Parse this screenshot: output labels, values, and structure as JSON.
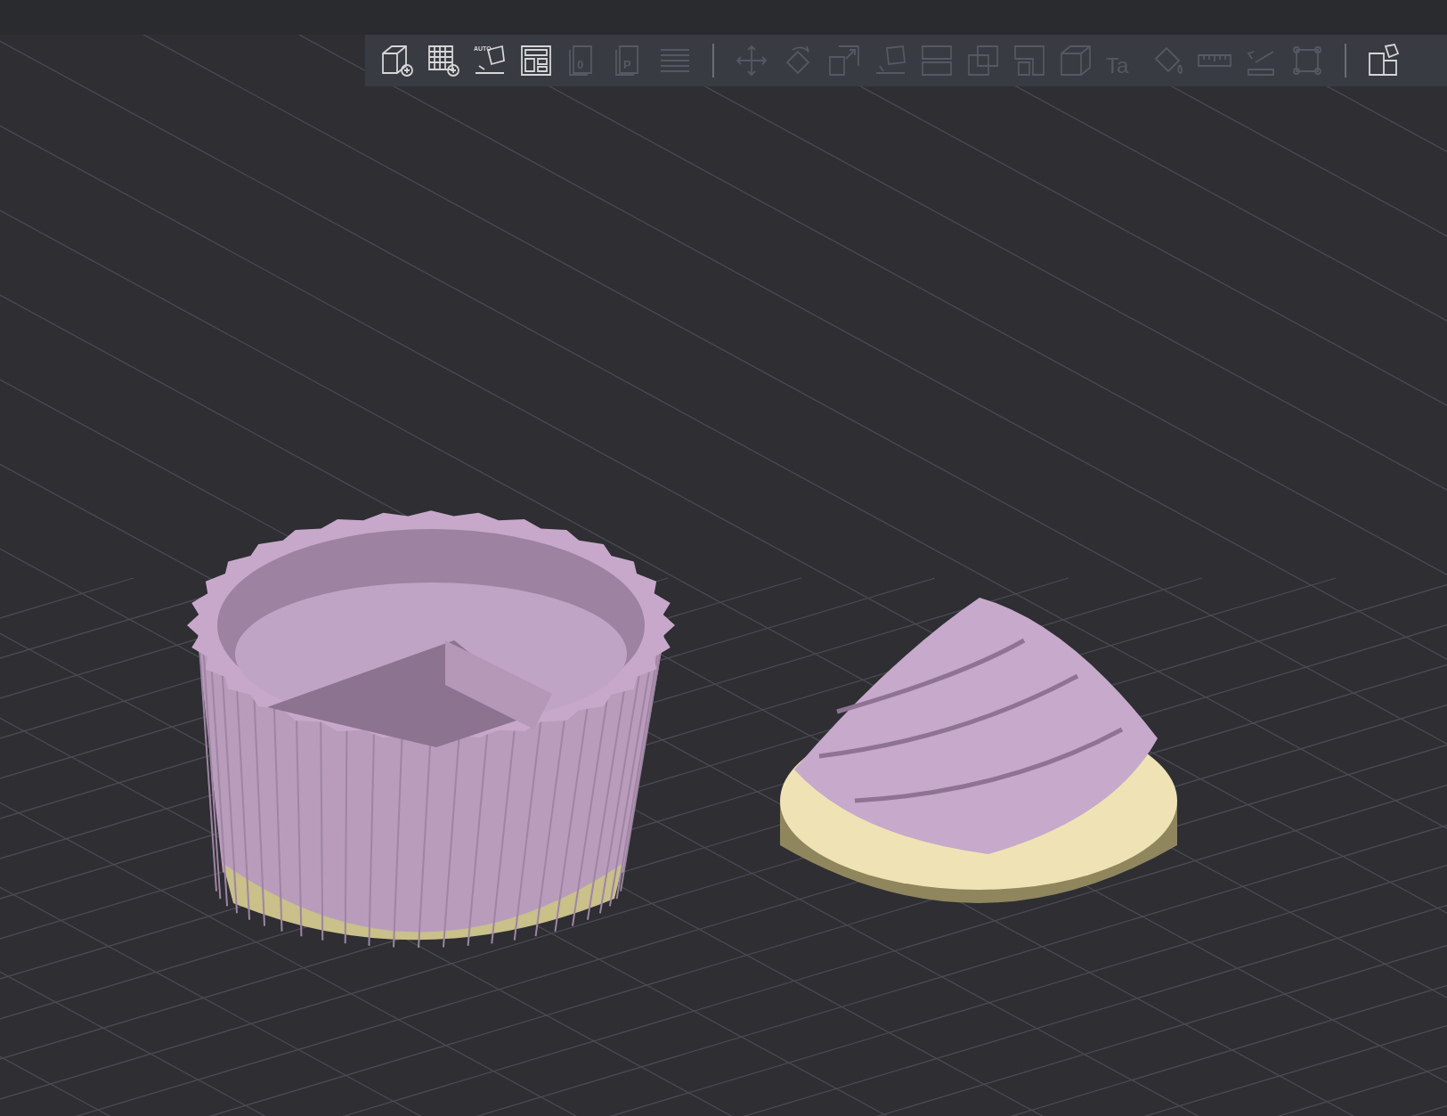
{
  "toolbar": {
    "items": [
      {
        "kind": "add-cube",
        "disabled": false
      },
      {
        "kind": "add-grid",
        "disabled": false
      },
      {
        "kind": "auto-orient",
        "disabled": false,
        "glyph": "AUTO"
      },
      {
        "kind": "arrange",
        "disabled": false
      },
      {
        "kind": "plate",
        "disabled": true,
        "glyph": "0"
      },
      {
        "kind": "plate",
        "disabled": true,
        "glyph": "P"
      },
      {
        "kind": "lines",
        "disabled": true
      },
      {
        "kind": "separator"
      },
      {
        "kind": "move",
        "disabled": true
      },
      {
        "kind": "rotate",
        "disabled": true
      },
      {
        "kind": "scale",
        "disabled": true
      },
      {
        "kind": "lay-flat",
        "disabled": true
      },
      {
        "kind": "split",
        "disabled": true
      },
      {
        "kind": "overlap",
        "disabled": true
      },
      {
        "kind": "corner",
        "disabled": true
      },
      {
        "kind": "cube",
        "disabled": true
      },
      {
        "kind": "text",
        "disabled": true,
        "glyph": "Ta"
      },
      {
        "kind": "paint",
        "disabled": true
      },
      {
        "kind": "ruler",
        "disabled": true
      },
      {
        "kind": "emboss",
        "disabled": true
      },
      {
        "kind": "frame",
        "disabled": true
      },
      {
        "kind": "separator"
      },
      {
        "kind": "puzzle",
        "disabled": false
      }
    ]
  }
}
